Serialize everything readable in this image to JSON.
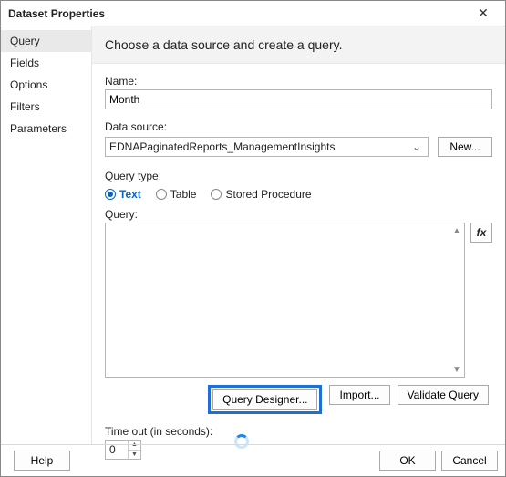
{
  "window": {
    "title": "Dataset Properties"
  },
  "sidebar": {
    "items": [
      {
        "label": "Query",
        "selected": true
      },
      {
        "label": "Fields",
        "selected": false
      },
      {
        "label": "Options",
        "selected": false
      },
      {
        "label": "Filters",
        "selected": false
      },
      {
        "label": "Parameters",
        "selected": false
      }
    ]
  },
  "main": {
    "heading": "Choose a data source and create a query.",
    "name_label": "Name:",
    "name_value": "Month",
    "datasource_label": "Data source:",
    "datasource_value": "EDNAPaginatedReports_ManagementInsights",
    "new_button": "New...",
    "querytype_label": "Query type:",
    "querytype_options": [
      {
        "label": "Text",
        "checked": true
      },
      {
        "label": "Table",
        "checked": false
      },
      {
        "label": "Stored Procedure",
        "checked": false
      }
    ],
    "query_label": "Query:",
    "fx_label": "fx",
    "buttons": {
      "query_designer": "Query Designer...",
      "import": "Import...",
      "validate": "Validate Query"
    },
    "timeout_label": "Time out (in seconds):",
    "timeout_value": "0"
  },
  "footer": {
    "help": "Help",
    "ok": "OK",
    "cancel": "Cancel"
  }
}
